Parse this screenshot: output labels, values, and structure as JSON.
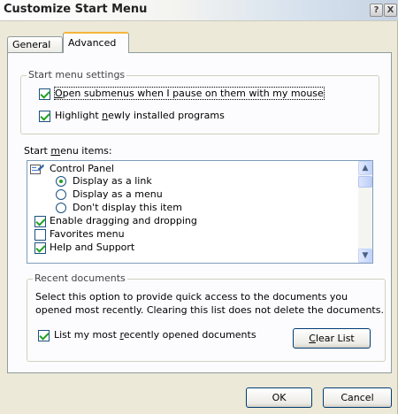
{
  "window": {
    "title": "Customize Start Menu",
    "help_glyph": "?",
    "close_glyph": "X"
  },
  "tabs": [
    {
      "label": "General"
    },
    {
      "label": "Advanced"
    }
  ],
  "start_menu_settings": {
    "legend": "Start menu settings",
    "open_submenus": {
      "prefix": "",
      "mnemonic": "O",
      "rest": "pen submenus when I pause on them with my mouse",
      "checked": true
    },
    "highlight_new": {
      "prefix": "Highlight ",
      "mnemonic": "n",
      "rest": "ewly installed programs",
      "checked": true
    }
  },
  "start_menu_items": {
    "label_prefix": "Start ",
    "label_mnemonic": "m",
    "label_rest": "enu items:",
    "items": [
      {
        "type": "icon",
        "icon": "control-panel-icon",
        "label": "Control Panel"
      },
      {
        "type": "radio",
        "label": "Display as a link",
        "selected": true
      },
      {
        "type": "radio",
        "label": "Display as a menu",
        "selected": false
      },
      {
        "type": "radio",
        "label": "Don't display this item",
        "selected": false
      },
      {
        "type": "checkbox",
        "label": "Enable dragging and dropping",
        "checked": true
      },
      {
        "type": "checkbox",
        "label": "Favorites menu",
        "checked": false
      },
      {
        "type": "checkbox",
        "label": "Help and Support",
        "checked": true
      }
    ],
    "scroll_up_glyph": "▲",
    "scroll_down_glyph": "▼"
  },
  "recent_documents": {
    "legend": "Recent documents",
    "description_line1": "Select this option to provide quick access to the documents you",
    "description_line2": "opened most recently.  Clearing this list does not delete the documents.",
    "list_recent": {
      "prefix": "List my most ",
      "mnemonic": "r",
      "rest": "ecently opened documents",
      "checked": true
    },
    "clear_list": {
      "mnemonic": "C",
      "rest": "lear List"
    }
  },
  "buttons": {
    "ok": "OK",
    "cancel": "Cancel"
  },
  "colors": {
    "accent_tab": "#f6b53a",
    "check_green": "#21a121"
  }
}
